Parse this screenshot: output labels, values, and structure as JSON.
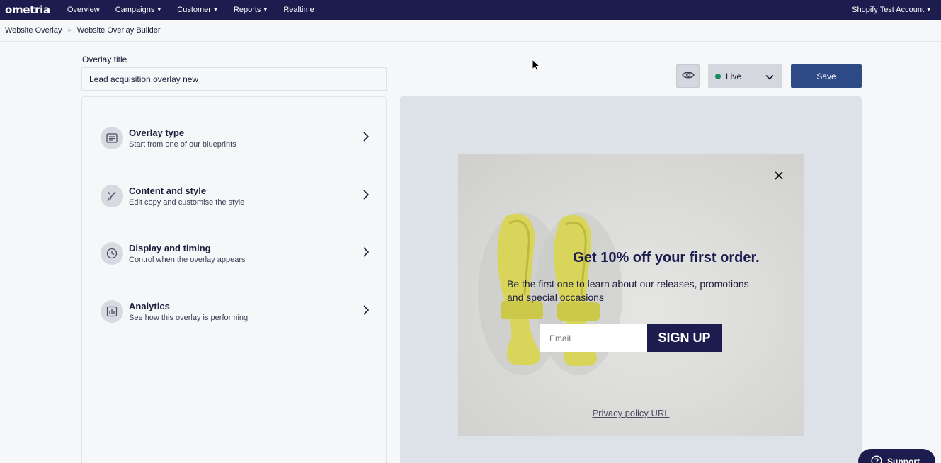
{
  "topnav": {
    "logo": "ometria",
    "items": [
      {
        "label": "Overview",
        "dropdown": false
      },
      {
        "label": "Campaigns",
        "dropdown": true
      },
      {
        "label": "Customer",
        "dropdown": true
      },
      {
        "label": "Reports",
        "dropdown": true
      },
      {
        "label": "Realtime",
        "dropdown": false
      }
    ],
    "account": "Shopify Test Account",
    "background_color": "#1c1d4e"
  },
  "breadcrumb": {
    "items": [
      "Website Overlay",
      "Website Overlay Builder"
    ],
    "separator": ">"
  },
  "form": {
    "title_label": "Overlay title",
    "title_value": "Lead acquisition overlay new"
  },
  "steps": [
    {
      "title": "Overlay type",
      "subtitle": "Start from one of our blueprints",
      "icon": "layout-icon"
    },
    {
      "title": "Content and style",
      "subtitle": "Edit copy and customise the style",
      "icon": "brush-icon"
    },
    {
      "title": "Display and timing",
      "subtitle": "Control when the overlay appears",
      "icon": "clock-icon"
    },
    {
      "title": "Analytics",
      "subtitle": "See how this overlay is performing",
      "icon": "analytics-icon"
    }
  ],
  "toolbar": {
    "preview_icon": "eye-icon",
    "status_value": "Live",
    "status_color": "#1a8b63",
    "save_label": "Save",
    "save_color": "#2d4a86"
  },
  "overlay": {
    "headline": "Get 10% off your first order.",
    "body": "Be the first one to learn about our releases, promotions and special occasions",
    "email_placeholder": "Email",
    "signup_label": "SIGN UP",
    "privacy_link": "Privacy policy URL",
    "accent_color": "#1c1d4e",
    "image_subject": "yellow-sandals"
  },
  "support": {
    "label": "Support",
    "icon": "question-icon"
  }
}
